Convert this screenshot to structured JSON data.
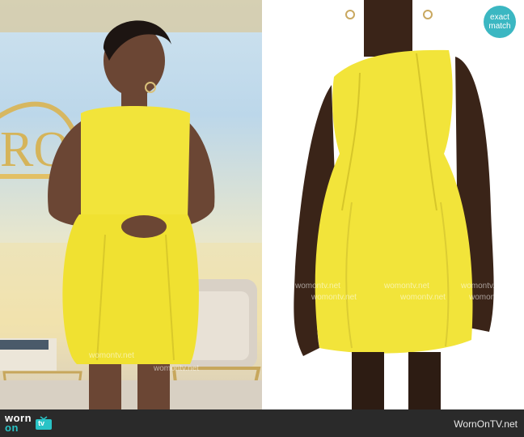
{
  "badge": {
    "line1": "exact",
    "line2": "match"
  },
  "footer": {
    "logo_top": "worn",
    "logo_bottom": "on",
    "logo_tv": "tv",
    "site": "WornOnTV.net"
  },
  "watermark": "womontv.net",
  "colors": {
    "dress": "#f2e43a",
    "footer_bg": "#2a2a2a",
    "badge_bg": "#3bb7c2",
    "accent": "#29c3c6"
  }
}
